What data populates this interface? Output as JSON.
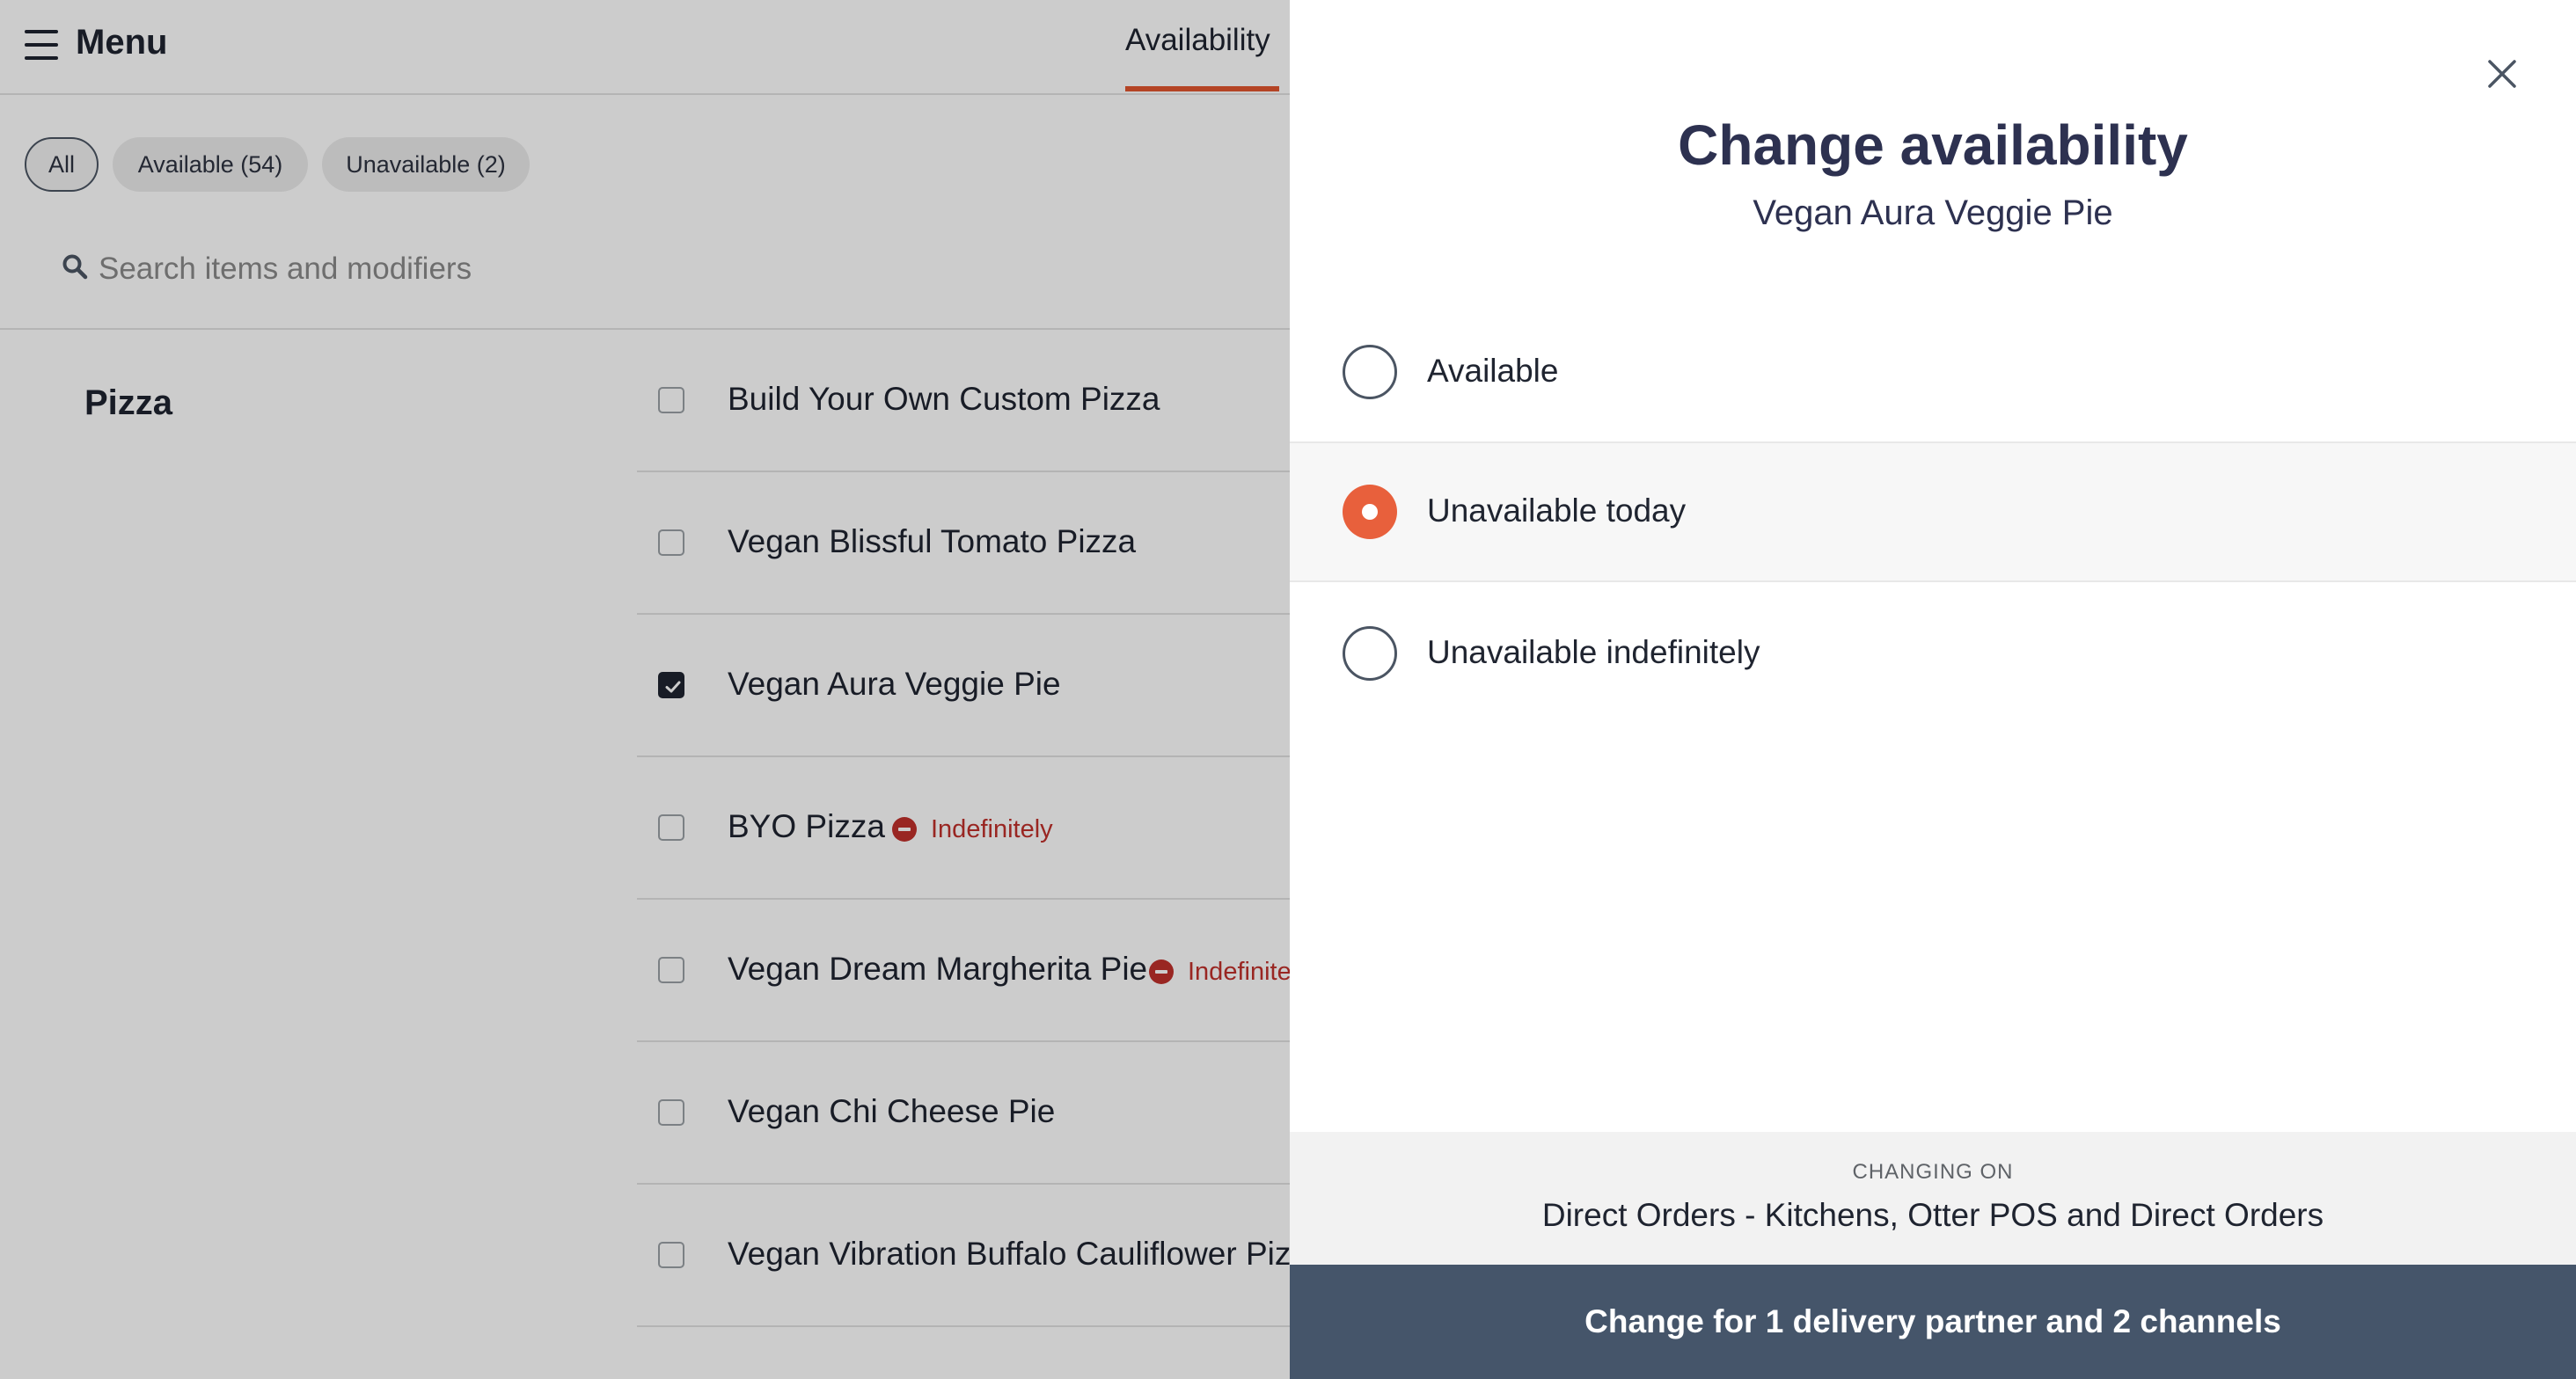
{
  "header": {
    "menu_title": "Menu",
    "tab_label": "Availability"
  },
  "filters": [
    {
      "label": "All",
      "active": true
    },
    {
      "label": "Available (54)",
      "active": false
    },
    {
      "label": "Unavailable (2)",
      "active": false
    }
  ],
  "search": {
    "placeholder": "Search items and modifiers"
  },
  "category": "Pizza",
  "items": [
    {
      "name": "Build Your Own Custom Pizza",
      "checked": false,
      "badge": ""
    },
    {
      "name": "Vegan Blissful Tomato Pizza",
      "checked": false,
      "badge": ""
    },
    {
      "name": "Vegan Aura Veggie Pie",
      "checked": true,
      "badge": ""
    },
    {
      "name": "BYO Pizza",
      "checked": false,
      "badge": "Indefinitely"
    },
    {
      "name": "Vegan Dream Margherita Pie",
      "checked": false,
      "badge": "Indefinitely"
    },
    {
      "name": "Vegan Chi Cheese Pie",
      "checked": false,
      "badge": ""
    },
    {
      "name": "Vegan Vibration Buffalo Cauliflower Pizza",
      "checked": false,
      "badge": ""
    }
  ],
  "drawer": {
    "title": "Change availability",
    "subtitle": "Vegan Aura Veggie Pie",
    "options": [
      {
        "label": "Available",
        "selected": false
      },
      {
        "label": "Unavailable today",
        "selected": true
      },
      {
        "label": "Unavailable indefinitely",
        "selected": false
      }
    ],
    "changing_on_label": "CHANGING ON",
    "changing_on_value": "Direct Orders - Kitchens, Otter POS and Direct Orders",
    "submit_label": "Change for 1 delivery partner and 2 channels"
  },
  "colors": {
    "accent": "#e8603c",
    "submit_bg": "#45556a",
    "danger": "#c0302b",
    "title": "#2d3150"
  },
  "icons": {
    "menu": "hamburger-icon",
    "search": "search-icon",
    "close": "close-icon",
    "checkbox_check": "check-icon",
    "badge": "minus-circle-icon"
  }
}
